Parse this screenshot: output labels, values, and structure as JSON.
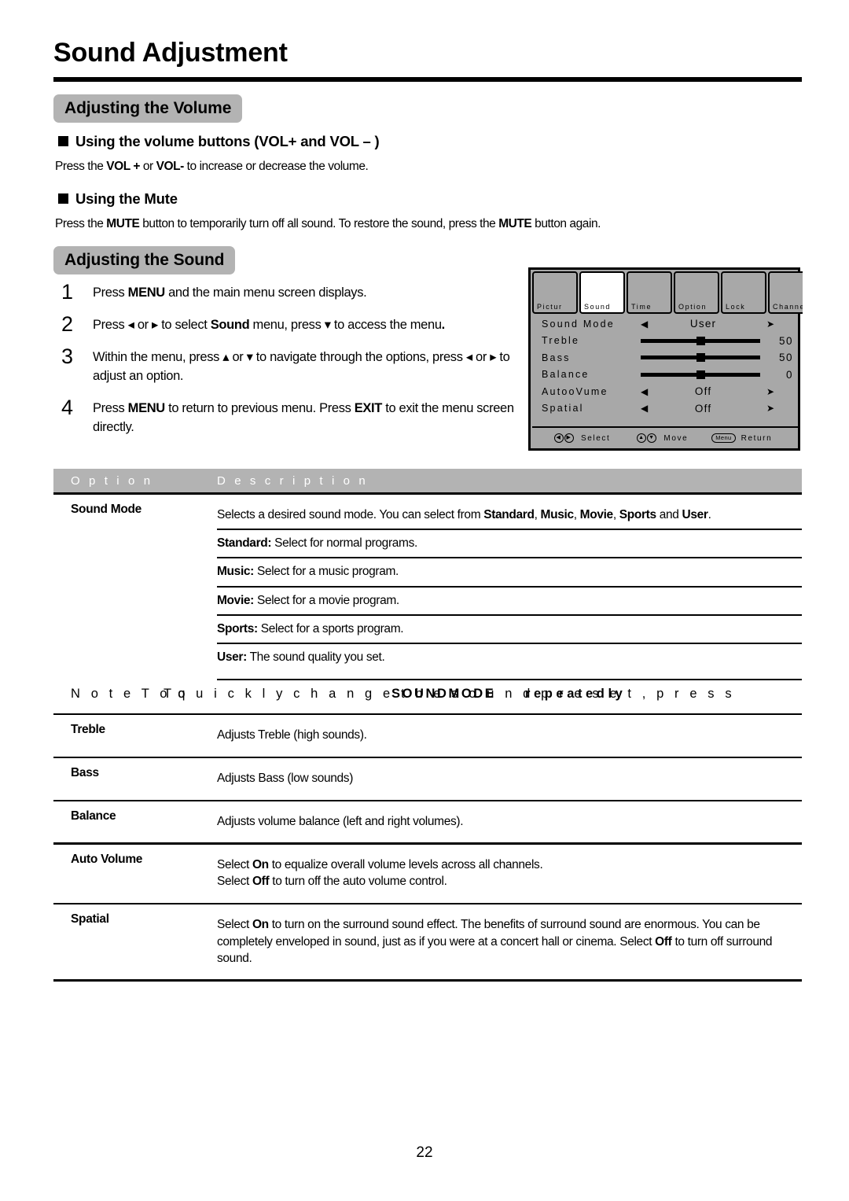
{
  "document": {
    "title": "Sound Adjustment",
    "page_number": "22"
  },
  "sections": {
    "volume": {
      "heading": "Adjusting the Volume",
      "sub1": "Using the volume buttons (VOL+ and VOL – )",
      "sub1_body_pre": "Press the ",
      "sub1_body_b1": "VOL +",
      "sub1_body_mid": " or ",
      "sub1_body_b2": "VOL-",
      "sub1_body_post": " to increase or decrease the volume.",
      "sub2": "Using the Mute",
      "sub2_body_pre": "Press the ",
      "sub2_body_b1": "MUTE",
      "sub2_body_mid": " button to temporarily turn off all sound.   To restore the sound, press the ",
      "sub2_body_b2": "MUTE",
      "sub2_body_post": " button again."
    },
    "sound": {
      "heading": "Adjusting the Sound"
    }
  },
  "steps": [
    {
      "num": "1",
      "parts": [
        {
          "t": "Press ",
          "b": false
        },
        {
          "t": "MENU",
          "b": true
        },
        {
          "t": " and the main menu screen displays.",
          "b": false
        }
      ]
    },
    {
      "num": "2",
      "parts": [
        {
          "t": "Press ◂ or ▸ to select ",
          "b": false
        },
        {
          "t": "Sound",
          "b": true
        },
        {
          "t": " menu,  press ▾ to access the menu",
          "b": false
        },
        {
          "t": ".",
          "b": true
        }
      ]
    },
    {
      "num": "3",
      "parts": [
        {
          "t": "Within the menu, press ▴ or ▾ to navigate through the options, press ◂ or ▸ to adjust an option.",
          "b": false
        }
      ]
    },
    {
      "num": "4",
      "parts": [
        {
          "t": "Press ",
          "b": false
        },
        {
          "t": "MENU",
          "b": true
        },
        {
          "t": " to return to previous menu. Press ",
          "b": false
        },
        {
          "t": "EXIT",
          "b": true
        },
        {
          "t": " to exit the menu screen directly.",
          "b": false
        }
      ]
    }
  ],
  "osd": {
    "tabs": [
      {
        "label": "Pictur",
        "active": false
      },
      {
        "label": "Sound",
        "active": true
      },
      {
        "label": "Time",
        "active": false
      },
      {
        "label": "Option",
        "active": false
      },
      {
        "label": "Lock",
        "active": false
      },
      {
        "label": "Channel",
        "active": false
      }
    ],
    "rows": [
      {
        "label": "Sound Mode",
        "kind": "select",
        "value": "User",
        "left_arrow": "◀",
        "right_arrow": "➤"
      },
      {
        "label": "Treble",
        "kind": "slider",
        "value": "50",
        "knob_pct": 50
      },
      {
        "label": "Bass",
        "kind": "slider",
        "value": "50",
        "knob_pct": 50
      },
      {
        "label": "Balance",
        "kind": "slider",
        "value": "0",
        "knob_pct": 50
      },
      {
        "label": "AutooVume",
        "kind": "select",
        "value": "Off",
        "left_arrow": "◀",
        "right_arrow": "➤"
      },
      {
        "label": "Spatial",
        "kind": "select",
        "value": "Off",
        "left_arrow": "◀",
        "right_arrow": "➤"
      }
    ],
    "footer": [
      {
        "key_left": "◀",
        "key_right": "▶",
        "label": "Select",
        "type": "arrows"
      },
      {
        "key_left": "▲",
        "key_right": "▼",
        "label": "Move",
        "type": "arrows"
      },
      {
        "key_left": "Menu",
        "key_right": "",
        "label": "Return",
        "type": "cap"
      }
    ],
    "colors": {
      "background": "#a8a8a8",
      "active_tab": "#ffffff",
      "border": "#000000"
    }
  },
  "table": {
    "headers": {
      "option": "O p t i o n",
      "description": "D e s c r i p t i o n"
    },
    "rows": [
      {
        "option": "Sound Mode",
        "descriptions": [
          {
            "parts": [
              {
                "t": "Selects a desired sound mode.  You can select from ",
                "b": false
              },
              {
                "t": "Standard",
                "b": true
              },
              {
                "t": ", ",
                "b": false
              },
              {
                "t": "Music",
                "b": true
              },
              {
                "t": ", ",
                "b": false
              },
              {
                "t": "Movie",
                "b": true
              },
              {
                "t": ", ",
                "b": false
              },
              {
                "t": "Sports",
                "b": true
              },
              {
                "t": " and ",
                "b": false
              },
              {
                "t": "User",
                "b": true
              },
              {
                "t": ".",
                "b": false
              }
            ]
          },
          {
            "parts": [
              {
                "t": "Standard:",
                "b": true
              },
              {
                "t": " Select for normal programs.",
                "b": false
              }
            ]
          },
          {
            "parts": [
              {
                "t": "Music:",
                "b": true
              },
              {
                "t": " Select for a music program.",
                "b": false
              }
            ]
          },
          {
            "parts": [
              {
                "t": "Movie:",
                "b": true
              },
              {
                "t": " Select for a movie program.",
                "b": false
              }
            ]
          },
          {
            "parts": [
              {
                "t": "Sports:",
                "b": true
              },
              {
                "t": " Select for a sports program.",
                "b": false
              }
            ]
          },
          {
            "parts": [
              {
                "t": "User:",
                "b": true
              },
              {
                "t": " The sound quality you set.",
                "b": false
              }
            ]
          }
        ]
      },
      {
        "option": "Treble",
        "descriptions": [
          {
            "parts": [
              {
                "t": "Adjusts Treble (high sounds).",
                "b": false
              }
            ]
          }
        ]
      },
      {
        "option": "Bass",
        "descriptions": [
          {
            "parts": [
              {
                "t": "Adjusts Bass (low sounds)",
                "b": false
              }
            ]
          }
        ]
      },
      {
        "option": "Balance",
        "descriptions": [
          {
            "parts": [
              {
                "t": "Adjusts volume balance (left and right volumes).",
                "b": false
              }
            ]
          }
        ]
      },
      {
        "option": "Auto Volume",
        "descriptions": [
          {
            "parts": [
              {
                "t": "Select ",
                "b": false
              },
              {
                "t": "On",
                "b": true
              },
              {
                "t": " to equalize overall volume levels across all channels.",
                "b": false
              },
              {
                "t": "\n",
                "b": false
              },
              {
                "t": "Select ",
                "b": false
              },
              {
                "t": "Off",
                "b": true
              },
              {
                "t": " to turn off the auto volume control.",
                "b": false
              }
            ]
          }
        ]
      },
      {
        "option": "Spatial",
        "descriptions": [
          {
            "parts": [
              {
                "t": "Select ",
                "b": false
              },
              {
                "t": "On",
                "b": true
              },
              {
                "t": " to turn on the surround sound effect. The benefits of surround sound are enormous. You can be completely enveloped in sound, just as if you were at a concert hall or cinema. Select ",
                "b": false
              },
              {
                "t": "Off",
                "b": true
              },
              {
                "t": " to turn off surround sound.",
                "b": false
              }
            ]
          }
        ]
      }
    ],
    "note": {
      "base": "N o t e       T o   q u i c k l y   c h a n g e   t h e   s o u n d   p r e s e t ,   p r e s s",
      "overlay_1": "T o",
      "overlay_2": "S O U N D   M O D E",
      "overlay_3": "r e p e a t e d l y"
    }
  }
}
